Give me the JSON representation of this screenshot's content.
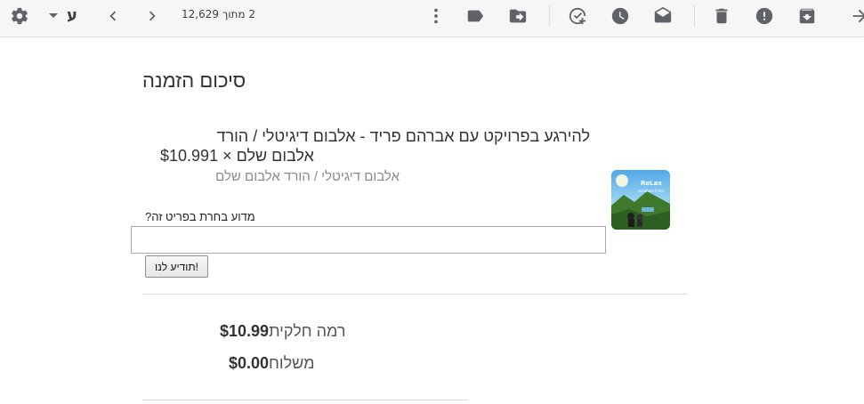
{
  "toolbar": {
    "pagination": "2 מתוך 12,629",
    "language": "ע",
    "icons": [
      "settings-icon",
      "language-dropdown",
      "older-icon",
      "newer-icon",
      "more-icon",
      "label-icon",
      "move-to-icon",
      "add-to-tasks-icon",
      "snooze-icon",
      "mark-unread-icon",
      "delete-icon",
      "report-spam-icon",
      "archive-icon",
      "back-icon"
    ]
  },
  "order": {
    "heading": "סיכום הזמנה",
    "product_title": "להירגע בפרויקט עם אברהם פריד - אלבום דיגיטלי / הורד",
    "product_title_line2": "אלבום שלם",
    "price": "$10.99",
    "quantity": "1 ×",
    "variant": "אלבום דיגיטלי / הורד אלבום שלם",
    "thumb_text": "ReLax",
    "thumb_subtext": "Avraham Fried",
    "why_label": "מדוע בחרת בפריט זה?",
    "why_value": "",
    "tell_button": "תודיע לנו!"
  },
  "summary": {
    "subtotal_label": "רמה חלקית",
    "subtotal_value": "$10.99",
    "shipping_label": "משלוח",
    "shipping_value": "$0.00"
  }
}
